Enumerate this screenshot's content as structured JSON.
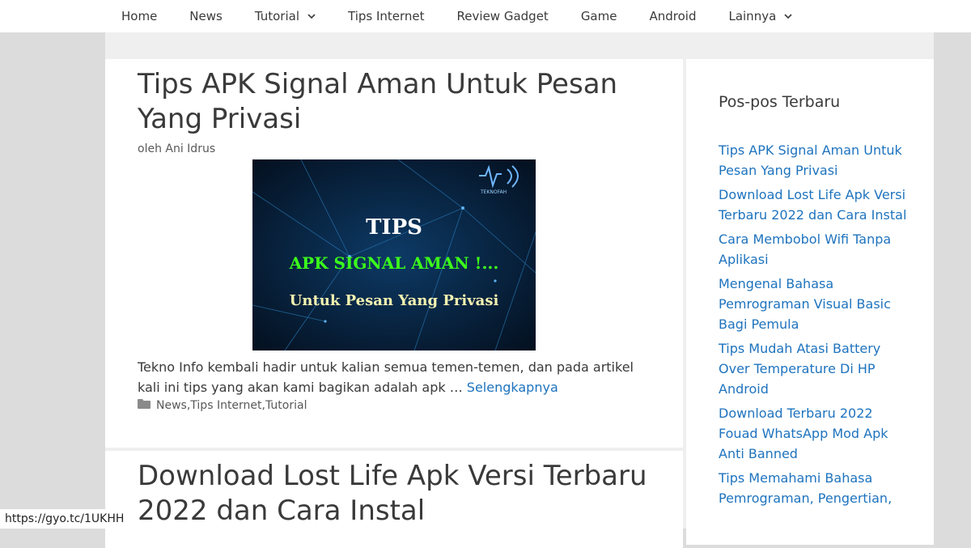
{
  "nav": {
    "items": [
      {
        "label": "Home"
      },
      {
        "label": "News"
      },
      {
        "label": "Tutorial"
      },
      {
        "label": "Tips Internet"
      },
      {
        "label": "Review Gadget"
      },
      {
        "label": "Game"
      },
      {
        "label": "Android"
      },
      {
        "label": "Lainnya"
      }
    ]
  },
  "article1": {
    "title": "Tips APK Signal Aman Untuk Pesan Yang Privasi",
    "byline": "oleh Ani Idrus",
    "image": {
      "line1": "TIPS",
      "line2": "APK SIGNAL AMAN !...",
      "line3": "Untuk Pesan Yang Privasi",
      "logo_text": "TEKNOFAH"
    },
    "excerpt": "Tekno Info kembali hadir untuk kalian semua temen-temen, dan pada artikel kali ini tips yang akan kami bagikan adalah apk …",
    "read_more": "Selengkapnya",
    "categories": [
      "News",
      "Tips Internet",
      "Tutorial"
    ],
    "category_sep": ", "
  },
  "article2": {
    "title": "Download Lost Life Apk Versi Terbaru 2022 dan Cara Instal"
  },
  "sidebar": {
    "widget_title": "Pos-pos Terbaru",
    "recent_posts": [
      "Tips APK Signal Aman Untuk Pesan Yang Privasi",
      "Download Lost Life Apk Versi Terbaru 2022 dan Cara Instal",
      "Cara Membobol Wifi Tanpa Aplikasi",
      "Mengenal Bahasa Pemrograman Visual Basic Bagi Pemula",
      "Tips Mudah Atasi Battery Over Temperature Di HP Android",
      "Download Terbaru 2022 Fouad WhatsApp Mod Apk Anti Banned",
      "Tips Memahami Bahasa Pemrograman, Pengertian,"
    ]
  },
  "status_bar": {
    "url": "https://gyo.tc/1UKHH"
  },
  "colors": {
    "link": "#1e73be",
    "text": "#3a3a3a",
    "background": "#efefef"
  }
}
